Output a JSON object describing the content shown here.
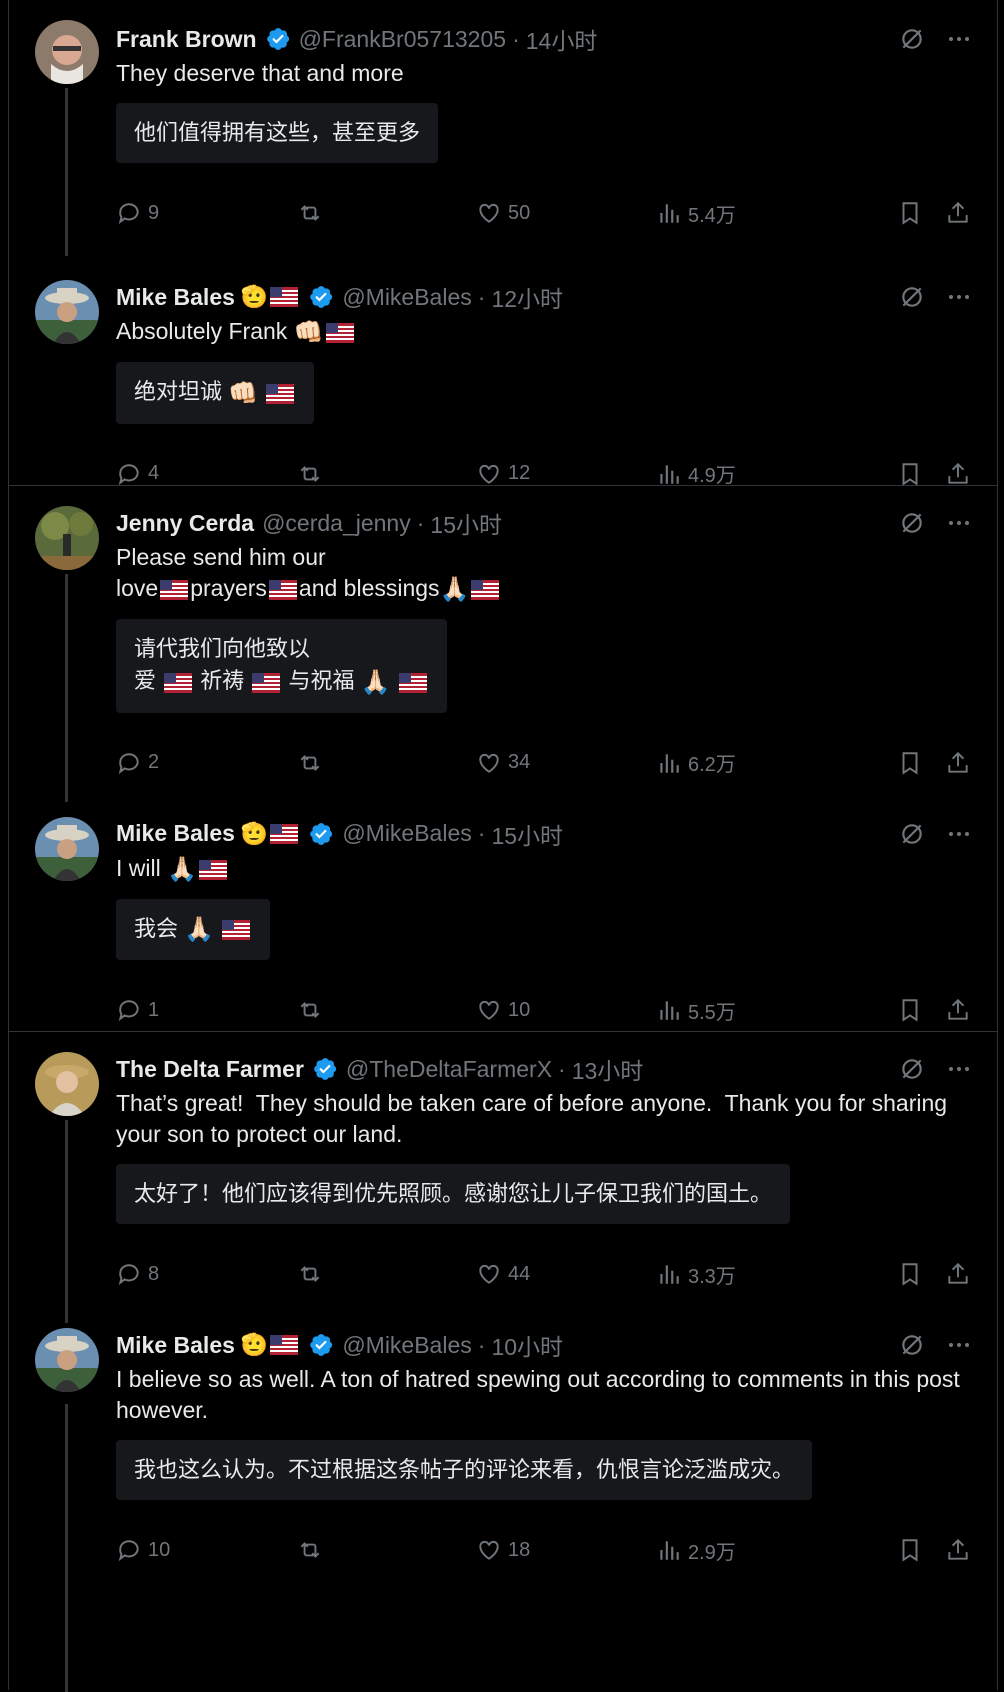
{
  "posts": [
    {
      "name": "Frank Brown",
      "handle": "@FrankBr05713205",
      "time": "14小时",
      "text": "They deserve that and more",
      "translation": "他们值得拥有这些，甚至更多",
      "replies": "9",
      "likes": "50",
      "views": "5.4万",
      "verified": true
    },
    {
      "name": "Mike Bales",
      "handle": "@MikeBales",
      "time": "12小时",
      "text": "Absolutely Frank",
      "translation": "绝对坦诚",
      "replies": "4",
      "likes": "12",
      "views": "4.9万",
      "verified": true
    },
    {
      "name": "Jenny Cerda",
      "handle": "@cerda_jenny",
      "time": "15小时",
      "text_line1": "Please send him our",
      "text_line2a": "love",
      "text_line2b": "prayers",
      "text_line2c": "and blessings",
      "translation_line1": "请代我们向他致以",
      "translation_line2a": "爱",
      "translation_line2b": "祈祷",
      "translation_line2c": "与祝福",
      "replies": "2",
      "likes": "34",
      "views": "6.2万",
      "verified": false
    },
    {
      "name": "Mike Bales",
      "handle": "@MikeBales",
      "time": "15小时",
      "text": "I will",
      "translation": "我会",
      "replies": "1",
      "likes": "10",
      "views": "5.5万",
      "verified": true
    },
    {
      "name": "The Delta Farmer",
      "handle": "@TheDeltaFarmerX",
      "time": "13小时",
      "text": "That’s great!  They should be taken care of before anyone.  Thank you for sharing your son to protect our land.",
      "translation": "太好了！他们应该得到优先照顾。感谢您让儿子保卫我们的国土。",
      "replies": "8",
      "likes": "44",
      "views": "3.3万",
      "verified": true
    },
    {
      "name": "Mike Bales",
      "handle": "@MikeBales",
      "time": "10小时",
      "text": "I believe so as well. A ton of hatred spewing out according to comments in this post however.",
      "translation": "我也这么认为。不过根据这条帖子的评论来看，仇恨言论泛滥成灾。",
      "replies": "10",
      "likes": "18",
      "views": "2.9万",
      "verified": true
    }
  ],
  "separator": "·",
  "colors": {
    "verified": "#1d9bf0",
    "muted": "#71767b",
    "translation_bg": "#16181c"
  },
  "icons": {
    "reply": "reply-icon",
    "retweet": "retweet-icon",
    "like": "like-icon",
    "views": "views-icon",
    "bookmark": "bookmark-icon",
    "share": "share-icon",
    "grok": "grok-icon",
    "more": "more-icon",
    "verified": "verified-badge-icon",
    "flag": "us-flag-icon",
    "pray": "folded-hands-icon",
    "fist": "fist-bump-icon"
  }
}
